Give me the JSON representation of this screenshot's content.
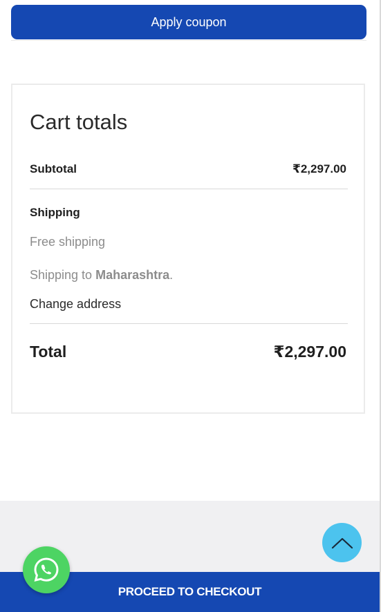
{
  "coupon": {
    "apply_label": "Apply coupon"
  },
  "cart_totals": {
    "title": "Cart totals",
    "subtotal_label": "Subtotal",
    "subtotal_value": "₹2,297.00",
    "shipping_label": "Shipping",
    "shipping_method": "Free shipping",
    "shipping_to_prefix": "Shipping to ",
    "shipping_region": "Maharashtra",
    "shipping_to_suffix": ".",
    "change_address_label": "Change address",
    "total_label": "Total",
    "total_value": "₹2,297.00"
  },
  "checkout": {
    "label": "PROCEED TO CHECKOUT"
  },
  "icons": {
    "scroll_top": "chevron-up-icon",
    "whatsapp": "whatsapp-icon"
  },
  "colors": {
    "primary": "#1548b2",
    "scroll_top": "#4cc3ee",
    "whatsapp": "#4dd463",
    "footer_band": "#f0f0f2"
  }
}
